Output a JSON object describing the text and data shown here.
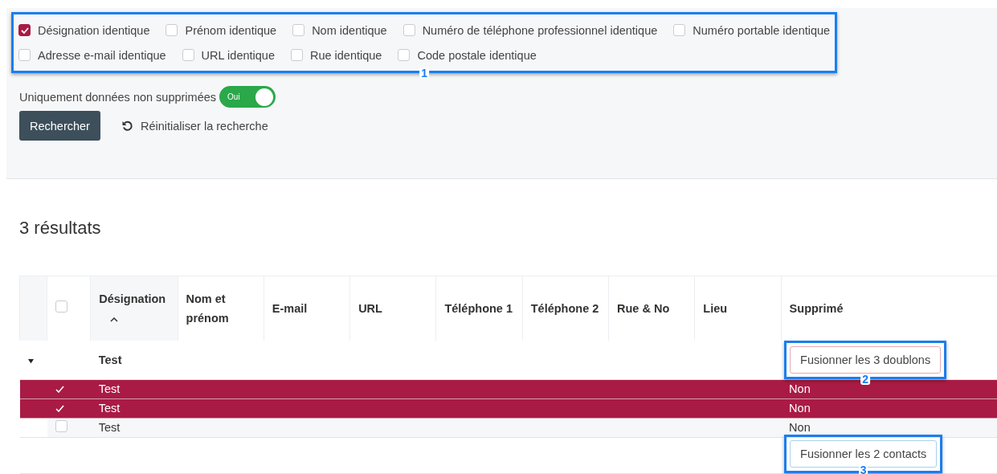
{
  "filters": {
    "callout": "1",
    "rows": [
      [
        {
          "label": "Désignation identique",
          "checked": true
        },
        {
          "label": "Prénom identique",
          "checked": false
        },
        {
          "label": "Nom identique",
          "checked": false
        },
        {
          "label": "Numéro de téléphone professionnel identique",
          "checked": false
        },
        {
          "label": "Numéro portable identique",
          "checked": false
        }
      ],
      [
        {
          "label": "Adresse e-mail identique",
          "checked": false
        },
        {
          "label": "URL identique",
          "checked": false
        },
        {
          "label": "Rue identique",
          "checked": false
        },
        {
          "label": "Code postale identique",
          "checked": false
        }
      ]
    ]
  },
  "toggle": {
    "label": "Uniquement données non supprimées",
    "on": true,
    "value": "Oui"
  },
  "search_button": "Rechercher",
  "reset_link": "Réinitialiser la recherche",
  "results_title": "3 résultats",
  "table": {
    "select_all_checked": false,
    "columns": [
      {
        "label": "Désignation",
        "sort_ascending": true
      },
      {
        "label": "Nom et prénom"
      },
      {
        "label": "E-mail"
      },
      {
        "label": "URL"
      },
      {
        "label": "Téléphone 1"
      },
      {
        "label": "Téléphone 2"
      },
      {
        "label": "Rue & No"
      },
      {
        "label": "Lieu"
      },
      {
        "label": "Supprimé"
      }
    ],
    "group": {
      "expanded": true,
      "designation": "Test",
      "merge_button": "Fusionner les 3 doublons",
      "callout": "2"
    },
    "rows": [
      {
        "selected": true,
        "designation": "Test",
        "deleted": "Non"
      },
      {
        "selected": true,
        "designation": "Test",
        "deleted": "Non"
      },
      {
        "selected": false,
        "designation": "Test",
        "deleted": "Non"
      }
    ],
    "footer": {
      "merge_button": "Fusionner les 2 contacts",
      "callout": "3"
    }
  }
}
